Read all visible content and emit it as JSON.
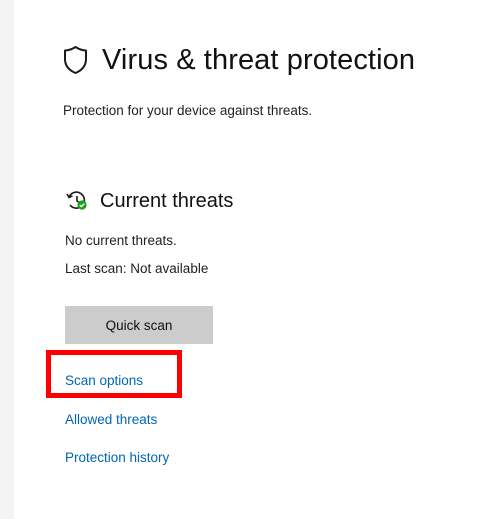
{
  "page": {
    "title": "Virus & threat protection",
    "subtitle": "Protection for your device against threats.",
    "icon": "shield-outline-icon"
  },
  "current_threats": {
    "title": "Current threats",
    "icon": "threat-scan-clock-check-icon",
    "status": "No current threats.",
    "last_scan": "Last scan: Not available",
    "quick_scan_label": "Quick scan",
    "links": {
      "scan_options": "Scan options",
      "allowed_threats": "Allowed threats",
      "protection_history": "Protection history"
    }
  },
  "highlight": {
    "target": "Scan options",
    "color": "#ff0000"
  },
  "colors": {
    "link": "#0066b4",
    "button_bg": "#cccccc",
    "status_check": "#16a116"
  }
}
